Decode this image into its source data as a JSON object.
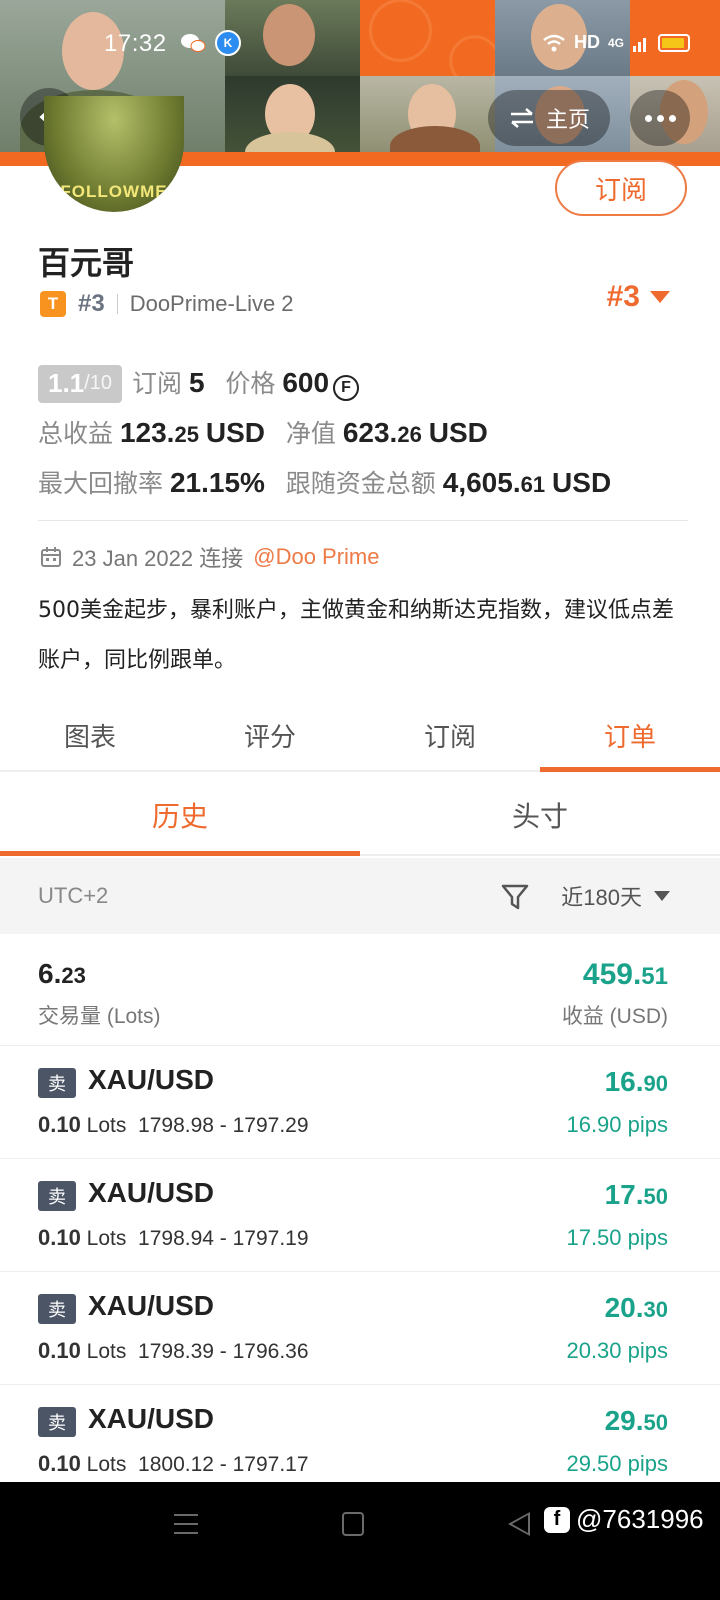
{
  "status_bar": {
    "time": "17:32",
    "network": "HD",
    "cellular": "4G"
  },
  "header": {
    "home_label": "主页"
  },
  "profile": {
    "avatar_text": "FOLLOWME",
    "subscribe_label": "订阅",
    "name": "百元哥",
    "tier_badge": "T",
    "rank_small": "#3",
    "server": "DooPrime-Live 2",
    "rank_big": "#3"
  },
  "stats": {
    "score": "1.1",
    "score_max": "/10",
    "subscribe_label": "订阅",
    "subscribe_count": "5",
    "price_label": "价格",
    "price_value": "600",
    "total_profit_label": "总收益",
    "total_profit_int": "123.",
    "total_profit_dec": "25",
    "total_profit_unit": "USD",
    "equity_label": "净值",
    "equity_int": "623.",
    "equity_dec": "26",
    "equity_unit": "USD",
    "max_drawdown_label": "最大回撤率",
    "max_drawdown_value": "21.15%",
    "follow_funds_label": "跟随资金总额",
    "follow_funds_int": "4,605.",
    "follow_funds_dec": "61",
    "follow_funds_unit": "USD"
  },
  "connection": {
    "date": "23 Jan 2022 连接",
    "broker": "@Doo Prime"
  },
  "description": "500美金起步，暴利账户，主做黄金和纳斯达克指数，建议低点差账户，同比例跟单。",
  "tabs": [
    {
      "label": "图表",
      "active": false
    },
    {
      "label": "评分",
      "active": false
    },
    {
      "label": "订阅",
      "active": false
    },
    {
      "label": "订单",
      "active": true
    }
  ],
  "subtabs": [
    {
      "label": "历史",
      "active": true
    },
    {
      "label": "头寸",
      "active": false
    }
  ],
  "filter": {
    "timezone": "UTC+2",
    "range": "近180天"
  },
  "summary": {
    "lots_int": "6.",
    "lots_dec": "23",
    "lots_label": "交易量 (Lots)",
    "profit_int": "459.",
    "profit_dec": "51",
    "profit_label": "收益 (USD)"
  },
  "orders": [
    {
      "side": "卖",
      "symbol": "XAU/USD",
      "lots": "0.10",
      "lots_unit": "Lots",
      "prices": "1798.98 - 1797.29",
      "profit_int": "16.",
      "profit_dec": "90",
      "pips": "16.90 pips"
    },
    {
      "side": "卖",
      "symbol": "XAU/USD",
      "lots": "0.10",
      "lots_unit": "Lots",
      "prices": "1798.94 - 1797.19",
      "profit_int": "17.",
      "profit_dec": "50",
      "pips": "17.50 pips"
    },
    {
      "side": "卖",
      "symbol": "XAU/USD",
      "lots": "0.10",
      "lots_unit": "Lots",
      "prices": "1798.39 - 1796.36",
      "profit_int": "20.",
      "profit_dec": "30",
      "pips": "20.30 pips"
    },
    {
      "side": "卖",
      "symbol": "XAU/USD",
      "lots": "0.10",
      "lots_unit": "Lots",
      "prices": "1800.12 - 1797.17",
      "profit_int": "29.",
      "profit_dec": "50",
      "pips": "29.50 pips"
    }
  ],
  "watermark": "@7631996",
  "colors": {
    "accent": "#ee6a2f",
    "profit": "#1aa38a",
    "banner": "#f26a21"
  }
}
